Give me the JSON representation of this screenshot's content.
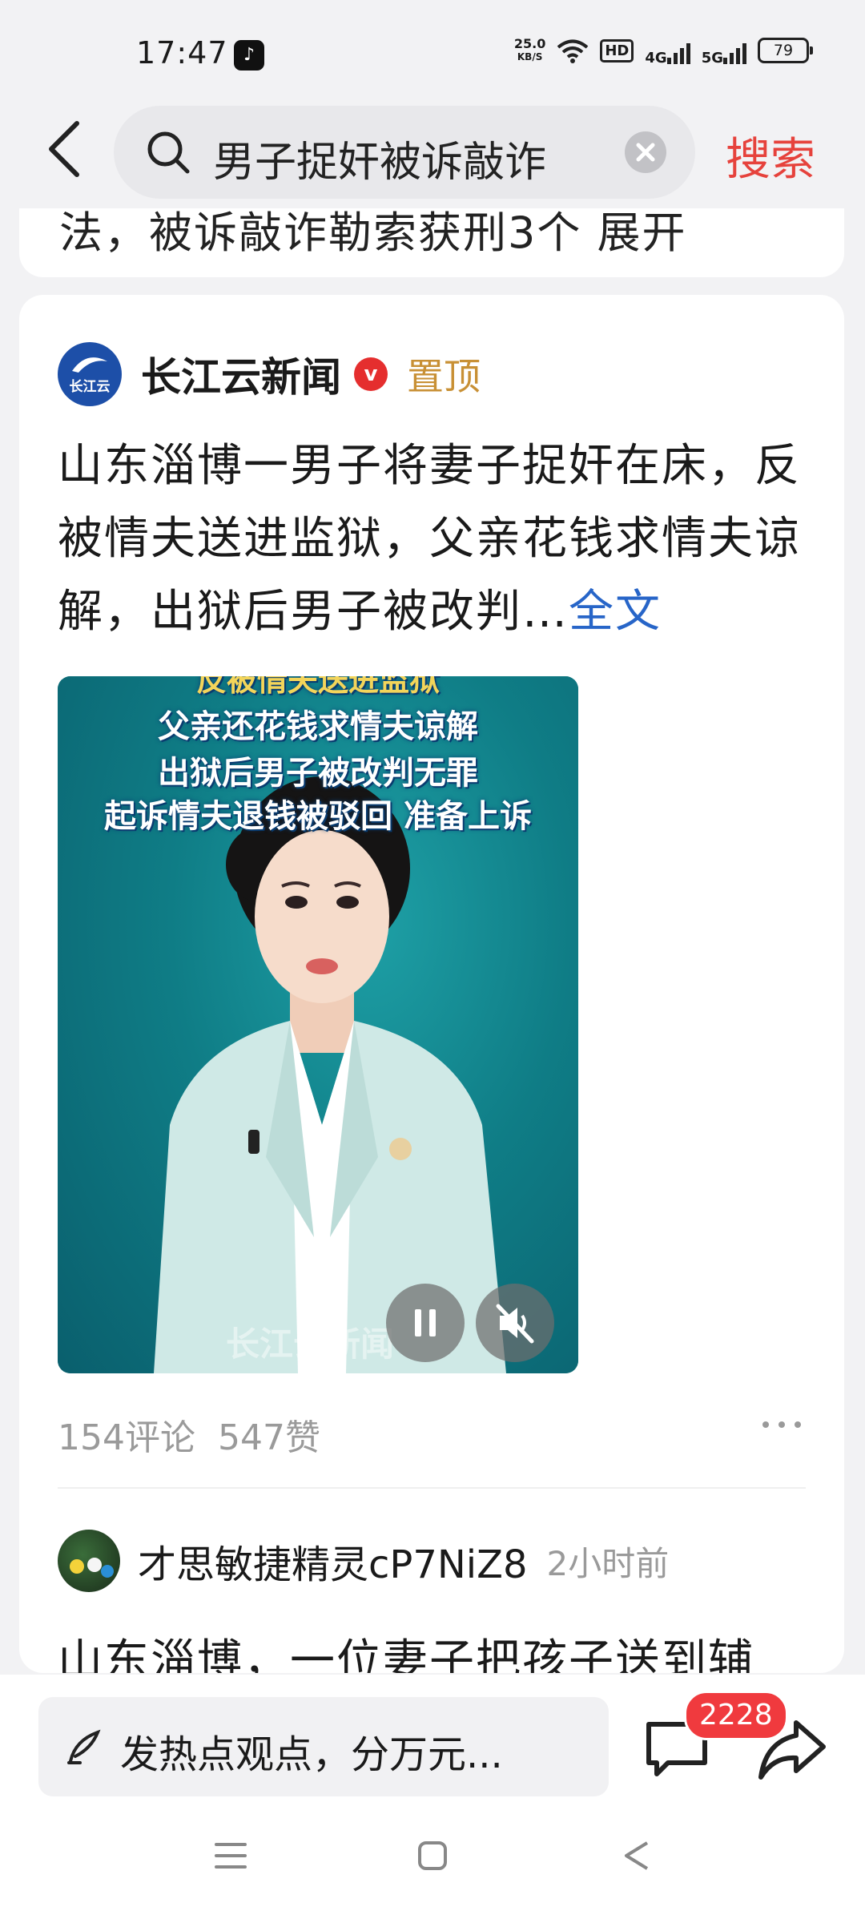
{
  "status_bar": {
    "time": "17:47",
    "app_icon": "douyin-icon",
    "net_speed_value": "25.0",
    "net_speed_unit": "KB/S",
    "hd_label": "HD",
    "net1": "4G",
    "net2": "5G",
    "battery": "79"
  },
  "header": {
    "query": "男子捉奸被诉敲诈",
    "search_label": "搜索"
  },
  "prev_card": {
    "clipped_text": "法，被诉敲诈勒索获刑3个  展开"
  },
  "post": {
    "author": "长江云新闻",
    "logo_text": "长江云",
    "verified_mark": "v",
    "pinned_label": "置顶",
    "text": "山东淄博一男子将妻子捉奸在床，反被情夫送进监狱，父亲花钱求情夫谅解，出狱后男子被改判…",
    "full_text_link": "全文",
    "video": {
      "caption_0": "反被情夫送进监狱",
      "caption_1": "父亲还花钱求情夫谅解",
      "caption_2": "出狱后男子被改判无罪",
      "caption_3": "起诉情夫退钱被驳回 准备上诉",
      "watermark": "长江云新闻"
    },
    "comments_count": "154评论",
    "likes_count": "547赞"
  },
  "comment": {
    "user": "才思敏捷精灵cP7NiZ8",
    "time": "2小时前",
    "text": "山东淄博，一位妻子把孩子送到辅"
  },
  "bottom_bar": {
    "input_placeholder": "发热点观点，分万元...",
    "comment_badge": "2228"
  },
  "colors": {
    "accent_red": "#e6423c",
    "link_blue": "#2765c8",
    "pinned_gold": "#c89035",
    "badge_red": "#f03a3e"
  }
}
